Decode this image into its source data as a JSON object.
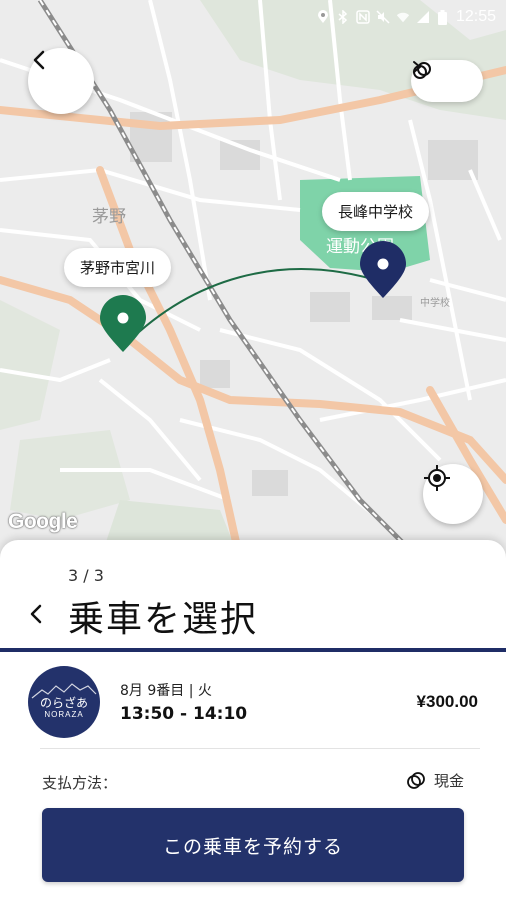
{
  "status_bar": {
    "time": "12:55",
    "icons": [
      "location-icon",
      "bluetooth-icon",
      "nfc-icon",
      "mute-icon",
      "wifi-icon",
      "signal-icon",
      "battery-icon"
    ]
  },
  "map": {
    "origin_label": "茅野市宮川",
    "destination_label": "長峰中学校",
    "attribution": "Google",
    "place_labels": [
      "茅野",
      "運動公園",
      "中学校"
    ],
    "colors": {
      "origin_pin": "#1e7a4f",
      "destination_pin": "#1f2d66",
      "route_line": "#1e6b45",
      "major_road": "#f3c7a6",
      "rail": "#8c8c8c"
    }
  },
  "sheet": {
    "step": "3 / 3",
    "title": "乗車を選択",
    "ride": {
      "logo_text": "のらざあ",
      "logo_subtext": "NORAZA",
      "date": "8月 9番目 | 火",
      "time_range": "13:50 - 14:10",
      "price": "¥300.00"
    },
    "payment_label": "支払方法：",
    "payment_method": "現金",
    "reserve_button": "この乗車を予約する"
  },
  "theme": {
    "primary": "#23326b",
    "background": "#ffffff"
  }
}
